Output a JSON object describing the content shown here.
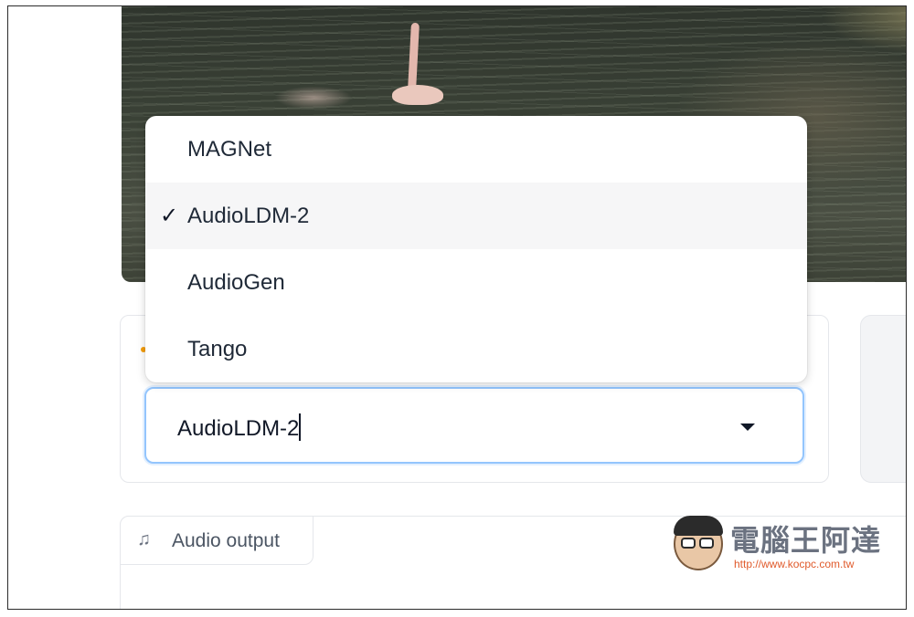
{
  "dropdown": {
    "options": [
      {
        "label": "MAGNet",
        "selected": false
      },
      {
        "label": "AudioLDM-2",
        "selected": true
      },
      {
        "label": "AudioGen",
        "selected": false
      },
      {
        "label": "Tango",
        "selected": false
      }
    ],
    "check_glyph": "✓"
  },
  "model_select": {
    "value": "AudioLDM-2",
    "accent_color": "#93c5fd"
  },
  "audio_output": {
    "icon": "music-note-icon",
    "label": "Audio output"
  },
  "watermark": {
    "title": "電腦王阿達",
    "url": "http://www.kocpc.com.tw"
  }
}
